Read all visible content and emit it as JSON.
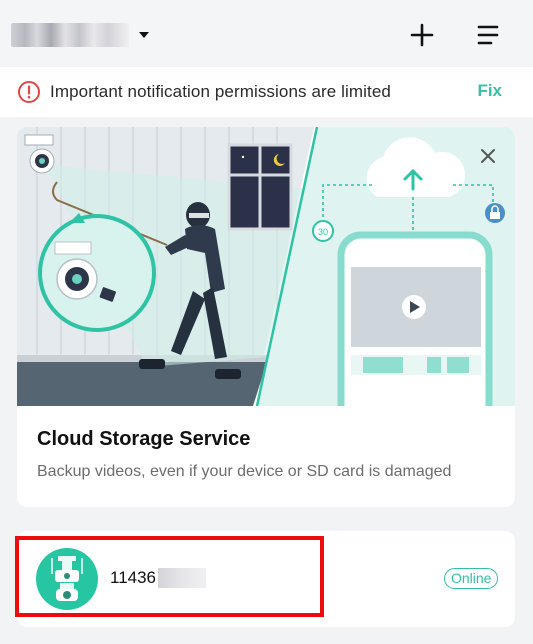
{
  "header": {
    "add_icon": "plus-icon",
    "menu_icon": "menu-icon",
    "selector_icon": "caret-down-icon"
  },
  "notice": {
    "icon": "alert-circle-icon",
    "text": "Important notification permissions are limited",
    "action_label": "Fix",
    "accent_color": "#3bbfa6",
    "alert_color": "#e04848"
  },
  "cloud_card": {
    "title": "Cloud Storage Service",
    "description": "Backup videos, even if your device or SD card is damaged",
    "close_icon": "close-icon",
    "rewind_badge": "30"
  },
  "device": {
    "name_prefix": "11436",
    "status": "Online",
    "status_color": "#34bfa3",
    "avatar_color": "#27c6a2",
    "icon": "outdoor-camera-icon"
  }
}
